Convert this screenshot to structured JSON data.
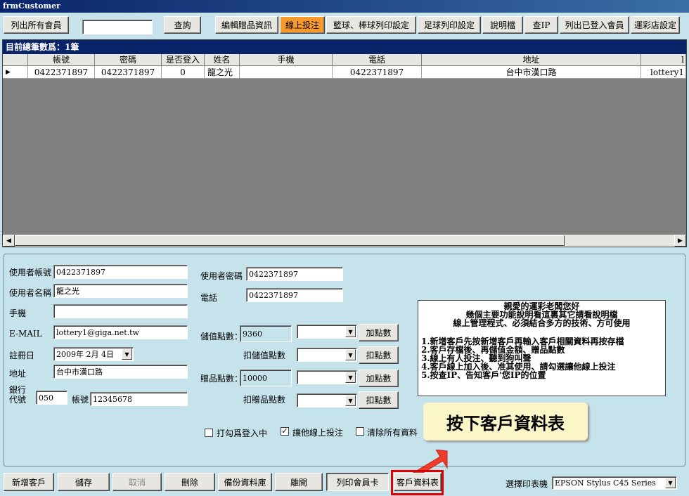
{
  "window": {
    "title": "frmCustomer"
  },
  "toolbar": {
    "list_all": "列出所有會員",
    "search_value": "",
    "query": "查詢",
    "edit_gifts": "編輯贈品資訊",
    "online_bet": "線上投注",
    "basketball_print": "籃球、棒球列印設定",
    "football_print": "足球列印設定",
    "help": "說明檔",
    "check_ip": "查IP",
    "list_logged_in": "列出已登入會員",
    "lottery_shop": "運彩店設定"
  },
  "grid": {
    "caption": "目前總筆數爲：1筆",
    "columns": [
      "帳號",
      "密碼",
      "是否登入",
      "姓名",
      "手機",
      "電話",
      "地址",
      "l"
    ],
    "rows": [
      [
        "0422371897",
        "0422371897",
        "0",
        "龍之光",
        "",
        "0422371897",
        "台中市漢口路",
        "lottery1"
      ]
    ]
  },
  "form": {
    "account_label": "使用者帳號",
    "account_value": "0422371897",
    "name_label": "使用者名稱",
    "name_value": "龍之光",
    "mobile_label": "手機",
    "mobile_value": "",
    "email_label": "E-MAIL",
    "email_value": "lottery1@giga.net.tw",
    "regdate_label": "註冊日",
    "regdate_value": "2009年  2月  4日",
    "address_label": "地址",
    "address_value": "台中市漢口路",
    "bank_label": "銀行代號",
    "bank_value": "050",
    "bank_account_label": "帳號",
    "bank_account_value": "12345678",
    "password_label": "使用者密碼",
    "password_value": "0422371897",
    "phone_label": "電話",
    "phone_value": "0422371897",
    "stored_points_label": "儲值點數：",
    "stored_points_value": "9360",
    "deduct_stored_label": "扣儲值點數",
    "gift_points_label": "贈品點數：",
    "gift_points_value": "10000",
    "deduct_gift_label": "扣贈品點數",
    "add_points_btn": "加點數",
    "deduct_points_btn": "扣點數",
    "check_logged_in": "打勾爲登入中",
    "check_online_bet": "讓他線上投注",
    "check_clear_all": "清除所有資料",
    "check_logged_in_state": "",
    "check_online_bet_state": "✓",
    "check_clear_all_state": ""
  },
  "info": {
    "title": "親愛的運彩老闆您好",
    "line1": "幾個主要功能說明看這裏其它請看說明檔",
    "line2": "線上管理程式、必須結合多方的技術、方可使用",
    "items": [
      "1.新增客戶先按新增客戶再輸入客戶相關資料再按存檔",
      "2.客戶存檔後、再儲值金額、贈品點數",
      "3.線上有人投注、聽到狗叫聲",
      "4.客戶線上加入後、准其使用、請勾選讓他線上投注",
      "5.按查IP、告知客戶'您IP的位置"
    ]
  },
  "callout": {
    "text": "按下客戶資料表"
  },
  "bottom": {
    "new_customer": "新增客戶",
    "save": "儲存",
    "cancel": "取消",
    "delete": "刪除",
    "backup": "備份資料庫",
    "exit": "離開",
    "print_card": "列印會員卡",
    "customer_sheet": "客戶資料表",
    "printer_label": "選擇印表機",
    "printer_value": "EPSON Stylus C45 Series"
  },
  "colors": {
    "accent": "#f79a2b",
    "highlight": "#e00000",
    "panel_bg": "#c6e3ec",
    "caption_bg": "#0a246a"
  }
}
